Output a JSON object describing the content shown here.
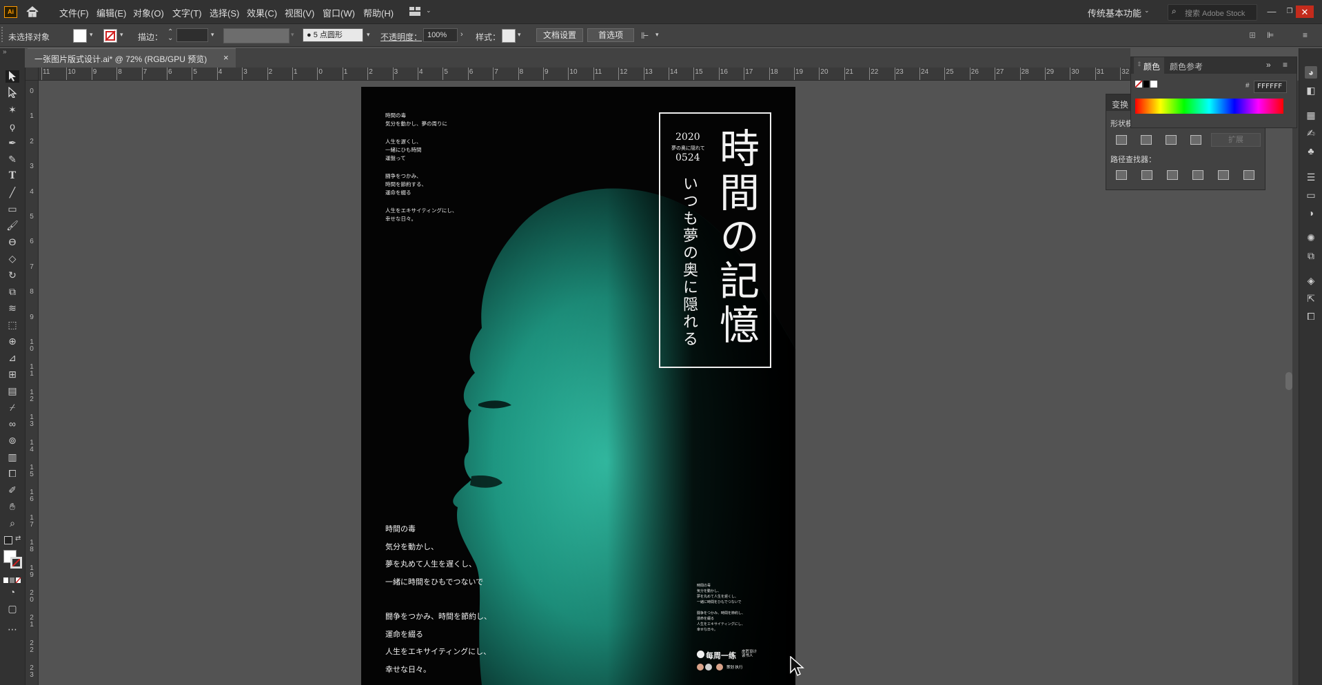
{
  "app": {
    "logo": "Ai",
    "home_icon": "home-icon"
  },
  "menu": {
    "items": [
      "文件(F)",
      "编辑(E)",
      "对象(O)",
      "文字(T)",
      "选择(S)",
      "效果(C)",
      "视图(V)",
      "窗口(W)",
      "帮助(H)"
    ],
    "workspace": "传统基本功能",
    "search_placeholder": "搜索 Adobe Stock"
  },
  "control": {
    "selection": "未选择对象",
    "stroke_label": "描边：",
    "brush": "5 点圆形",
    "opacity_label": "不透明度：",
    "opacity": "100%",
    "style_label": "样式：",
    "doc_setup": "文档设置",
    "preferences": "首选项"
  },
  "tab": {
    "title": "一张图片版式设计.ai* @ 72% (RGB/GPU 预览)",
    "close": "×"
  },
  "ruler": {
    "top": [
      "11",
      "10",
      "9",
      "8",
      "7",
      "6",
      "5",
      "4",
      "3",
      "2",
      "1",
      "0",
      "1",
      "2",
      "3",
      "4",
      "5",
      "6",
      "7",
      "8",
      "9",
      "10",
      "11",
      "12",
      "13",
      "14",
      "15",
      "16",
      "17",
      "18",
      "19",
      "20",
      "21",
      "22",
      "23",
      "24",
      "25",
      "26",
      "27",
      "28",
      "29",
      "30",
      "31",
      "32"
    ],
    "left": [
      "0",
      "1",
      "2",
      "3",
      "4",
      "5",
      "6",
      "7",
      "8",
      "9",
      "10",
      "11",
      "12",
      "13",
      "14",
      "15",
      "16",
      "17",
      "18",
      "19",
      "20",
      "21",
      "22",
      "23",
      "24"
    ]
  },
  "poster": {
    "small_top_left": [
      "時間の毒",
      "気分を動かし、夢の周りに",
      "",
      "人生を遅くし、",
      "一緒にひも時間",
      "運盤って",
      "",
      "闘争をつかみ、",
      "時間を節約する、",
      "運命を綴る",
      "",
      "人生をエキサイティングにし、",
      "幸せな日々。"
    ],
    "year": "2020",
    "sub_small": "夢の奥に隠れて",
    "date": "0524",
    "title_vertical": "時間の記憶",
    "subtitle_vertical": "いつも夢の奥に隠れる",
    "bottom_left": [
      "時間の毒",
      "気分を動かし、",
      "夢を丸めて人生を遅くし、",
      "一緒に時間をひもでつないで",
      "",
      "闘争をつかみ、時間を節約し、",
      "運命を綴る",
      "人生をエキサイティングにし、",
      "幸せな日々。"
    ],
    "bottom_right_small": [
      "時間の毒",
      "気分を動かし、",
      "夢を丸めて人生を遅くし、",
      "一緒に時間をひもでつないで",
      "",
      "闘争をつかみ、時間を節約し、",
      "運命を綴る",
      "人生をエキサイティングにし、",
      "幸せな日々。"
    ],
    "brand": "每周一练",
    "brand_sub": "皮匠设计 读书人",
    "credits": "策划 执行"
  },
  "panels": {
    "color_tab": "颜色",
    "color_guide_tab": "颜色参考",
    "hex_prefix": "#",
    "hex": "FFFFFF",
    "transform_tab": "变换",
    "shape_modes": "形状模式：",
    "expand": "扩展",
    "pathfinder": "路径查找器："
  },
  "colors": {
    "accent": "#2fd1b2",
    "poster_bg": "#040404"
  }
}
